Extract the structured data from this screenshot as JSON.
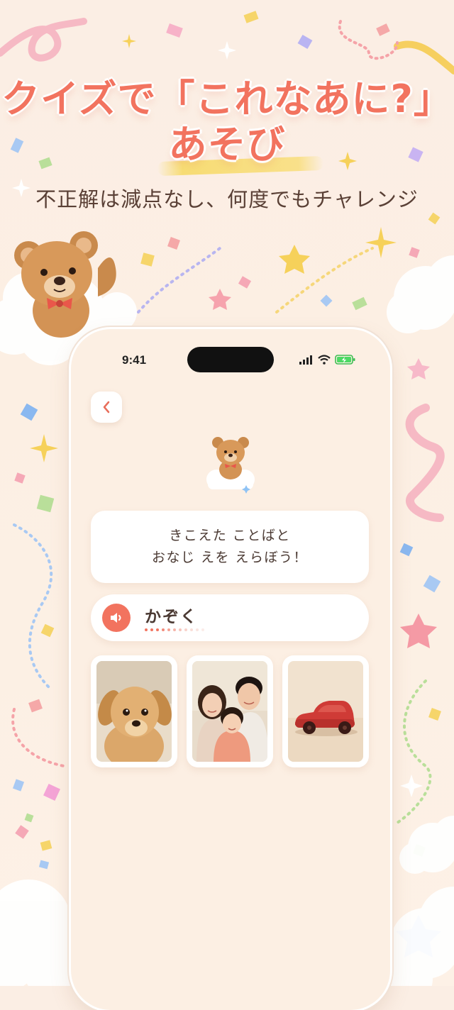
{
  "headline": {
    "line1": "クイズで「これなあに?」",
    "line2": "あそび"
  },
  "subline": "不正解は減点なし、何度でもチャレンジ",
  "phone": {
    "status": {
      "time": "9:41",
      "icons": [
        "cellular-signal-icon",
        "wifi-icon",
        "battery-charging-icon"
      ]
    },
    "back_icon": "chevron-left-icon",
    "mascot": "teddy-bear-on-cloud",
    "prompt": {
      "line1": "きこえた ことばと",
      "line2": "おなじ えを えらぼう！"
    },
    "word": {
      "icon": "speaker-icon",
      "text": "かぞく"
    },
    "choices": [
      {
        "subject": "puppy-photo"
      },
      {
        "subject": "family-photo"
      },
      {
        "subject": "toy-car-photo"
      }
    ]
  },
  "colors": {
    "accent": "#f2735f",
    "background": "#fcefe3",
    "text": "#4b3a33"
  }
}
